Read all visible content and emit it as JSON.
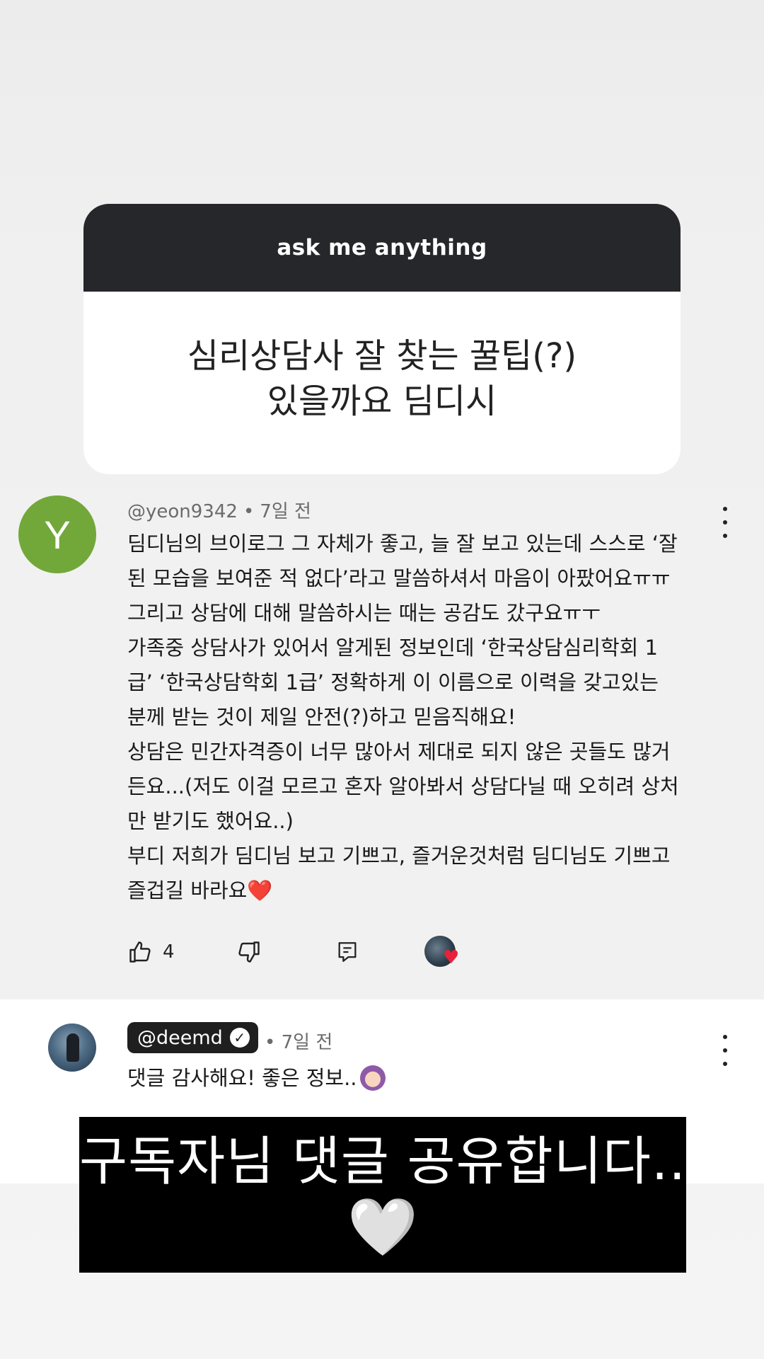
{
  "question_sticker": {
    "header": "ask me anything",
    "question_line1": "심리상담사 잘 찾는 꿀팁(?)",
    "question_line2": "있을까요 딤디시"
  },
  "comment": {
    "avatar_letter": "Y",
    "avatar_color": "#72a83a",
    "author": "@yeon9342",
    "separator": "•",
    "time": "7일 전",
    "lines": [
      "딤디님의 브이로그 그 자체가 좋고, 늘 잘 보고 있는데 스스로 ‘잘",
      "된 모습을 보여준 적 없다’라고 말씀하셔서 마음이 아팠어요ㅠㅠ",
      "그리고 상담에 대해 말씀하시는 때는 공감도 갔구요ㅠㅜ",
      "가족중 상담사가 있어서 알게된 정보인데 ‘한국상담심리학회 1",
      "급’ ‘한국상담학회 1급’ 정확하게 이 이름으로 이력을 갖고있는",
      "분께 받는 것이 제일 안전(?)하고 믿음직해요!",
      "상담은 민간자격증이 너무 많아서 제대로 되지 않은 곳들도 많거",
      "든요...(저도 이걸 모르고 혼자 알아봐서 상담다닐 때 오히려 상처",
      "만 받기도 했어요..)",
      "부디 저희가 딤디님 보고 기쁘고, 즐거운것처럼 딤디님도 기쁘고",
      "즐겁길 바라요"
    ],
    "heart_emoji": "❤️",
    "like_count": "4",
    "icons": [
      "thumbs-up-icon",
      "thumbs-down-icon",
      "reply-icon",
      "creator-heart-icon",
      "more-vert-icon"
    ]
  },
  "reply": {
    "author": "@deemd",
    "verified_mark": "✓",
    "separator": "•",
    "time": "7일 전",
    "text": "댓글 감사해요! 좋은 정보..",
    "icons": [
      "verified-icon",
      "person-gesture-emoji",
      "more-vert-icon"
    ]
  },
  "caption": {
    "text": "구독자님 댓글 공유합니다...",
    "heart": "🤍"
  }
}
